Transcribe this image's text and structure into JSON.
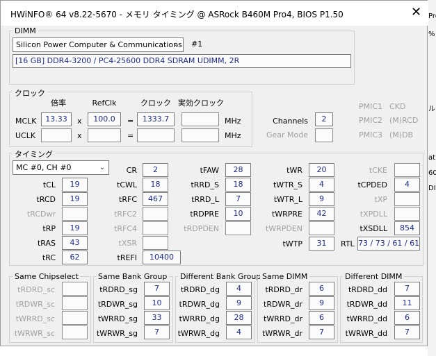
{
  "window": {
    "title": "HWiNFO® 64 v8.22-5670 - メモリ タイミング @ ASRock B460M Pro4, BIOS P1.50",
    "close_glyph": "✕"
  },
  "dimm": {
    "group_label": "DIMM",
    "manufacturer": "Silicon Power Computer & Communications",
    "slot": "#1",
    "description": "[16 GB] DDR4-3200 / PC4-25600 DDR4 SDRAM UDIMM, 2R"
  },
  "clock": {
    "group_label": "クロック",
    "col_ratio": "倍率",
    "col_refclk": "RefClk",
    "col_clock": "クロック",
    "col_effective": "実効クロック",
    "mclk_label": "MCLK",
    "mclk_ratio": "13.33",
    "mclk_refclk": "100.0",
    "mclk_clock": "1333.7",
    "mclk_effective": "",
    "uclk_label": "UCLK",
    "x_sign": "x",
    "eq_sign": "=",
    "unit": "MHz",
    "channels_label": "Channels",
    "channels_value": "2",
    "gearmode_label": "Gear Mode",
    "gearmode_value": "",
    "pmic1": "PMIC1",
    "pmic1_val": "CKD",
    "pmic2": "PMIC2",
    "pmic2_val": "(M)RCD",
    "pmic3": "PMIC3",
    "pmic3_val": "(M)DB"
  },
  "timing": {
    "group_label": "タイミング",
    "channel_select": "MC #0, CH #0",
    "tCL": "19",
    "tRCD": "19",
    "tRCDwr": "",
    "tRP": "19",
    "tRAS": "43",
    "tRC": "62",
    "CR": "2",
    "tCWL": "18",
    "tRFC": "467",
    "tRFC2": "",
    "tRFC4": "",
    "tXSR": "",
    "tREFI": "10400",
    "tFAW": "28",
    "tRRD_S": "18",
    "tRRD_L": "7",
    "tRDPRE": "10",
    "tRDPDEN": "",
    "tWR": "20",
    "tWTR_S": "4",
    "tWTR_L": "9",
    "tWRPRE": "42",
    "tWRPDEN": "",
    "tWTP": "31",
    "tCKE": "",
    "tCPDED": "4",
    "tXP": "",
    "tXPDLL": "",
    "tXSDLL": "854",
    "RTL_label": "RTL",
    "RTL": "73 / 73 / 61 / 61"
  },
  "same_chipselect": {
    "label": "Same Chipselect",
    "tRDRD_sc": "",
    "tRDWR_sc": "",
    "tWRRD_sc": "",
    "tWRWR_sc": ""
  },
  "same_bank_group": {
    "label": "Same Bank Group",
    "tRDRD_sg": "7",
    "tRDWR_sg": "10",
    "tWRRD_sg": "33",
    "tWRWR_sg": "7"
  },
  "diff_bank_group": {
    "label": "Different Bank Group",
    "tRDRD_dg": "4",
    "tRDWR_dg": "9",
    "tWRRD_dg": "28",
    "tWRWR_dg": "4"
  },
  "same_dimm": {
    "label": "Same DIMM",
    "tRDRD_dr": "6",
    "tRDWR_dr": "9",
    "tWRRD_dr": "6",
    "tWRWR_dr": "7"
  },
  "diff_dimm": {
    "label": "Different DIMM",
    "tRDRD_dd": "7",
    "tRDWR_dd": "11",
    "tWRRD_dd": "6",
    "tWRWR_dd": "7"
  },
  "background": {
    "t1": "Pro",
    "t2": "%",
    "t3": "ル",
    "t4": "at",
    "t5": "60",
    "t6": "DI"
  }
}
